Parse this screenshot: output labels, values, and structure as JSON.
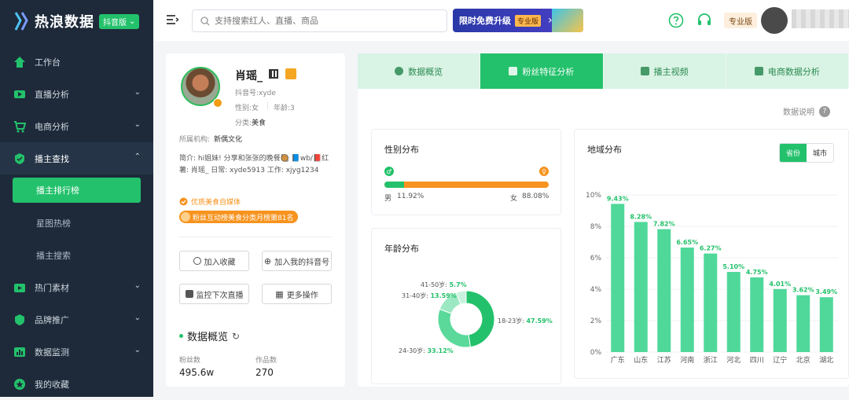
{
  "app": {
    "logo_text": "热浪数据",
    "edition_badge": "抖音版"
  },
  "sidebar": {
    "items": [
      {
        "label": "工作台",
        "icon": "home-icon"
      },
      {
        "label": "直播分析",
        "icon": "live-icon"
      },
      {
        "label": "电商分析",
        "icon": "cart-icon"
      },
      {
        "label": "播主查找",
        "icon": "find-icon"
      }
    ],
    "sub_items": [
      {
        "label": "播主排行榜",
        "active": true
      },
      {
        "label": "星图热榜"
      },
      {
        "label": "播主搜索"
      }
    ],
    "items2": [
      {
        "label": "热门素材",
        "icon": "media-icon"
      },
      {
        "label": "品牌推广",
        "icon": "brand-icon"
      },
      {
        "label": "数据监测",
        "icon": "monitor-icon"
      },
      {
        "label": "我的收藏",
        "icon": "star-icon"
      }
    ]
  },
  "topbar": {
    "search_placeholder": "支持搜索红人、直播、商品",
    "promo_text": "限时免费升级",
    "promo_badge": "专业版",
    "plan_badge": "专业版"
  },
  "profile": {
    "name": "肖瑶_",
    "douyin_id": "抖音号:xyde",
    "gender_label": "性别:女",
    "age_label": "年龄:3",
    "category_label": "分类:",
    "category": "美食",
    "org_label": "所属机构:",
    "org": "新偶文化",
    "bio": "简介: hi姐妹! 分享和张张的晚餐🥘 📘wb/📕红薯: 肖瑶_ 日常: xyde5913 工作: xjyg1234",
    "quality_tag": "优质美食自媒体",
    "rank_tag": "粉丝互动榜美食分类月榜第81名",
    "buttons": {
      "favorite": "加入收藏",
      "add_mine": "加入我的抖音号",
      "monitor": "监控下次直播",
      "more": "更多操作"
    },
    "overview_title": "数据概览",
    "fans_label": "粉丝数",
    "fans_value": "495.6w",
    "works_label": "作品数",
    "works_value": "270"
  },
  "tabs": [
    {
      "label": "数据概览",
      "active": false
    },
    {
      "label": "粉丝特征分析",
      "active": true
    },
    {
      "label": "播主视频",
      "active": false
    },
    {
      "label": "电商数据分析",
      "active": false
    }
  ],
  "data_note": "数据说明",
  "gender": {
    "title": "性别分布",
    "male_label": "男",
    "male_value": "11.92%",
    "male_pct": 11.92,
    "female_label": "女",
    "female_value": "88.08%",
    "female_pct": 88.08,
    "male_color": "#23c16b",
    "female_color": "#f7931e"
  },
  "age": {
    "title": "年龄分布"
  },
  "region": {
    "title": "地域分布",
    "toggle": {
      "province": "省份",
      "city": "城市"
    }
  },
  "chart_data": [
    {
      "type": "pie",
      "title": "年龄分布",
      "categories": [
        "18-23岁",
        "24-30岁",
        "31-40岁",
        "41-50岁"
      ],
      "values": [
        47.59,
        33.12,
        13.59,
        5.7
      ],
      "labels": [
        "47.59%",
        "33.12%",
        "13.59%",
        "5.7%"
      ],
      "colors": [
        "#23c16b",
        "#5ad99a",
        "#9be8c2",
        "#c8f2de"
      ]
    },
    {
      "type": "bar",
      "title": "地域分布",
      "categories": [
        "广东",
        "山东",
        "江苏",
        "河南",
        "浙江",
        "河北",
        "四川",
        "辽宁",
        "北京",
        "湖北"
      ],
      "values": [
        9.43,
        8.28,
        7.82,
        6.65,
        6.27,
        5.1,
        4.75,
        4.01,
        3.62,
        3.49
      ],
      "labels": [
        "9.43%",
        "8.28%",
        "7.82%",
        "6.65%",
        "6.27%",
        "5.10%",
        "4.75%",
        "4.01%",
        "3.62%",
        "3.49%"
      ],
      "yticks": [
        "0%",
        "2%",
        "4%",
        "6%",
        "8%",
        "10%"
      ],
      "ylim": [
        0,
        10
      ],
      "color": "#4fd89a"
    }
  ]
}
